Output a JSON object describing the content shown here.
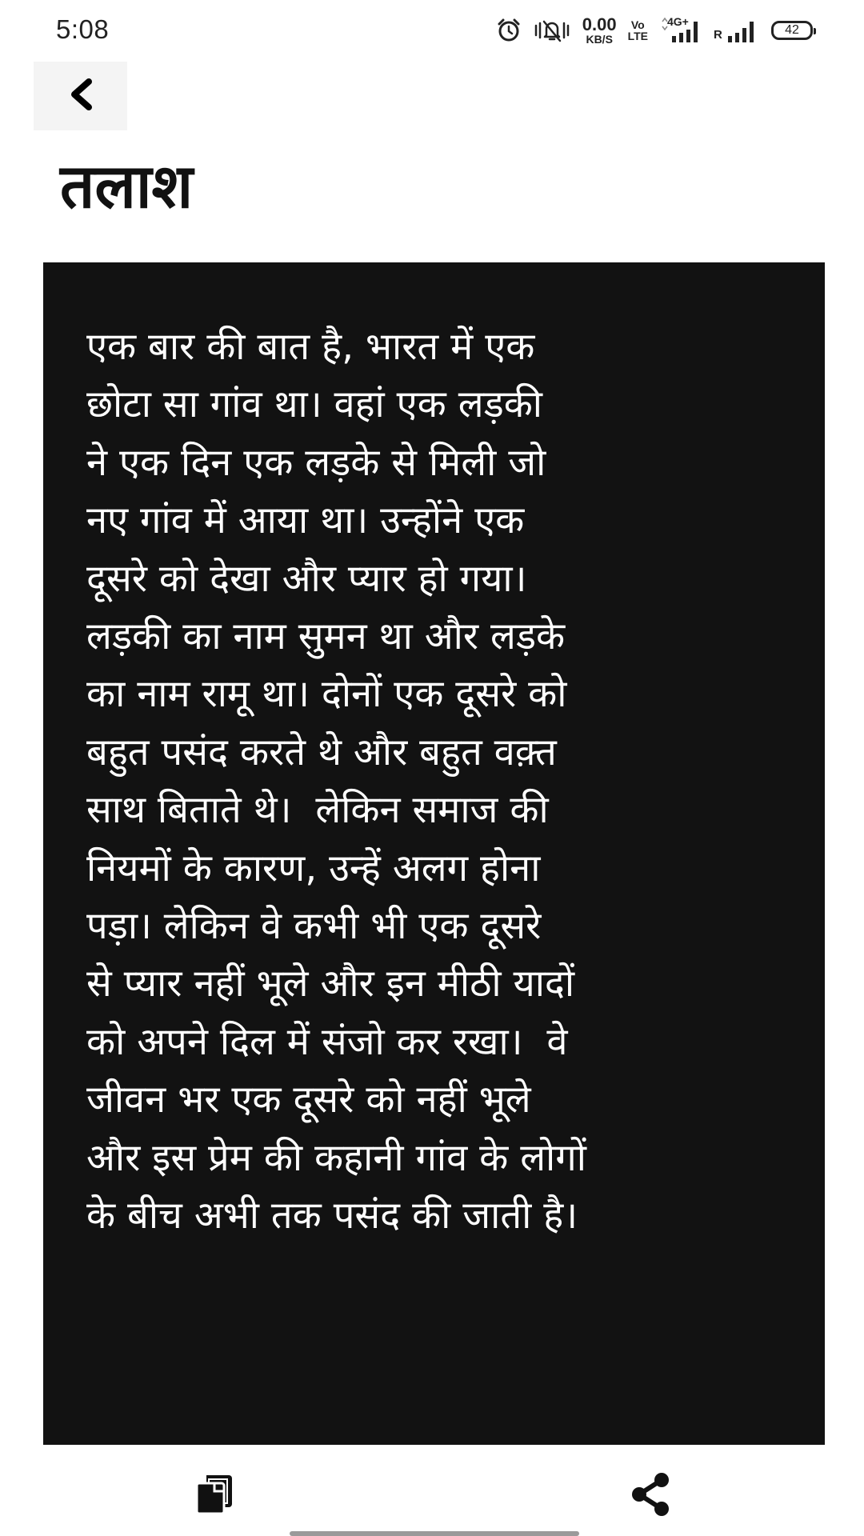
{
  "status_bar": {
    "time": "5:08",
    "net_speed_value": "0.00",
    "net_speed_unit": "KB/S",
    "volte_top": "Vo",
    "volte_bottom": "LTE",
    "network_type": "4G+",
    "roaming": "R",
    "battery_level": "42",
    "icons": [
      "alarm-icon",
      "vibrate-silent-icon",
      "signal-4g-icon",
      "signal-roaming-icon",
      "battery-icon"
    ]
  },
  "header": {
    "back_icon": "chevron-left-icon",
    "title": "तलाश"
  },
  "story": {
    "lines": [
      "एक बार की बात है, भारत में एक",
      "छोटा सा गांव था। वहां एक लड़की",
      "ने एक दिन एक लड़के से मिली जो",
      "नए गांव में आया था। उन्होंने एक",
      "दूसरे को देखा और प्यार हो गया।",
      "लड़की का नाम सुमन था और लड़के",
      "का नाम रामू था। दोनों एक दूसरे को",
      "बहुत पसंद करते थे और बहुत वक़्त",
      "साथ बिताते थे।  लेकिन समाज की",
      "नियमों के कारण, उन्हें अलग होना",
      "पड़ा। लेकिन वे कभी भी एक दूसरे",
      "से प्यार नहीं भूले और इन मीठी यादों",
      "को अपने दिल में संजो कर रखा।  वे",
      "जीवन भर एक दूसरे को नहीं भूले",
      "और इस प्रेम की कहानी गांव के लोगों",
      "के बीच अभी तक पसंद की जाती है।"
    ],
    "card_color": "#121212",
    "text_color": "#ffffff"
  },
  "bottom_bar": {
    "copy_icon": "copy-icon",
    "share_icon": "share-icon"
  }
}
